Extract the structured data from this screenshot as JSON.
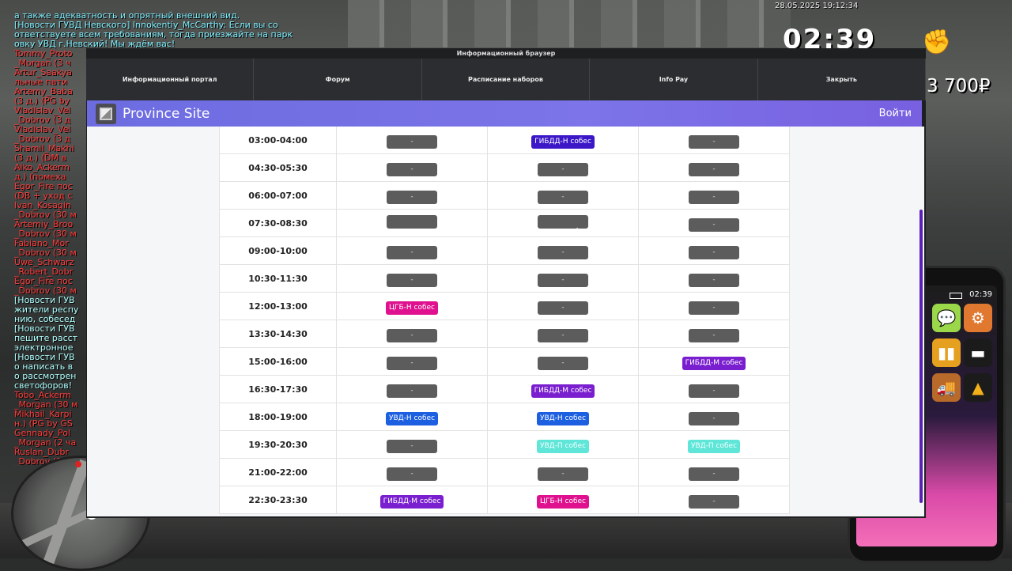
{
  "hud": {
    "datetime": "28.05.2025 19:12:34",
    "time": "02:39",
    "money": "3 700₽",
    "phone_time": "02:39"
  },
  "chat": [
    {
      "text": "а также адекватность и опрятный внешний вид.",
      "type": "info"
    },
    {
      "text": "[Новости ГУВД Невского] Innokentiy_McCarthy: Если вы со",
      "type": "info"
    },
    {
      "text": "ответствуете всем требованиям, тогда приезжайте на парк",
      "type": "info"
    },
    {
      "text": "овку УВД г.Невский! Мы ждём вас!",
      "type": "info"
    },
    {
      "text": "Tommy_Proto",
      "type": "nick"
    },
    {
      "text": "_Morgan (3 ч",
      "type": "nick"
    },
    {
      "text": "Artur_Saakya",
      "type": "nick"
    },
    {
      "text": "льные пати",
      "type": "nick"
    },
    {
      "text": "Artemy_Baba",
      "type": "nick"
    },
    {
      "text": "(3 д.) (PG by",
      "type": "nick"
    },
    {
      "text": "Vladislav_Vel",
      "type": "nick"
    },
    {
      "text": "_Dobrov (3 д",
      "type": "nick"
    },
    {
      "text": "Vladislav_Vel",
      "type": "nick"
    },
    {
      "text": "_Dobrov (3 д",
      "type": "nick"
    },
    {
      "text": "Shamil_Makhi",
      "type": "nick"
    },
    {
      "text": "(3 д.) (DM в",
      "type": "nick"
    },
    {
      "text": "Aiko_Ackerm",
      "type": "nick"
    },
    {
      "text": "д.) (помеха",
      "type": "nick"
    },
    {
      "text": "Egor_Fire пос",
      "type": "nick"
    },
    {
      "text": "(DB + уход с",
      "type": "nick"
    },
    {
      "text": "Ivan_Kosagin",
      "type": "nick"
    },
    {
      "text": "_Dobrov (30 м",
      "type": "nick"
    },
    {
      "text": "Artemiy_Broo",
      "type": "nick"
    },
    {
      "text": "_Dobrov (30 м",
      "type": "nick"
    },
    {
      "text": "Fabiano_Mor",
      "type": "nick"
    },
    {
      "text": "_Dobrov (30 м",
      "type": "nick"
    },
    {
      "text": "Uwe_Schwarz",
      "type": "nick"
    },
    {
      "text": "_Robert_Dobr",
      "type": "nick"
    },
    {
      "text": "Egor_Fire пос",
      "type": "nick"
    },
    {
      "text": "_Dobrov (30 м",
      "type": "nick"
    },
    {
      "text": "[Новости ГУВ",
      "type": "news"
    },
    {
      "text": "жители респу",
      "type": "news"
    },
    {
      "text": "нию, собесед",
      "type": "news"
    },
    {
      "text": "[Новости ГУВ",
      "type": "news"
    },
    {
      "text": "пешите расст",
      "type": "news"
    },
    {
      "text": "электронное",
      "type": "news"
    },
    {
      "text": "[Новости ГУВ",
      "type": "news"
    },
    {
      "text": "о написать в",
      "type": "news"
    },
    {
      "text": "о рассмотрен",
      "type": "news"
    },
    {
      "text": "светофоров!",
      "type": "news"
    },
    {
      "text": "Tobo_Ackerm",
      "type": "nick"
    },
    {
      "text": "_Morgan (30 м",
      "type": "nick"
    },
    {
      "text": "Mikhail_Karpi",
      "type": "nick"
    },
    {
      "text": "н.) (PG by GS",
      "type": "nick"
    },
    {
      "text": "Gennady_Pol",
      "type": "nick"
    },
    {
      "text": "_Morgan (2 ча",
      "type": "nick"
    },
    {
      "text": "Ruslan_Dubr",
      "type": "nick"
    },
    {
      "text": "_Dobrov (30 м",
      "type": "nick"
    }
  ],
  "browser": {
    "title": "Информационный браузер",
    "tabs": [
      {
        "label": "Информационный портал"
      },
      {
        "label": "Форум"
      },
      {
        "label": "Расписание наборов"
      },
      {
        "label": "Info Pay"
      },
      {
        "label": "Закрыть"
      }
    ]
  },
  "site": {
    "name": "Province Site",
    "login": "Войти"
  },
  "schedule": [
    {
      "time": "03:00-04:00",
      "slots": [
        {
          "label": "-",
          "kind": "empty"
        },
        {
          "label": "ГИБДД-Н собес",
          "kind": "gibdd-n"
        },
        {
          "label": "-",
          "kind": "empty"
        }
      ]
    },
    {
      "time": "04:30-05:30",
      "slots": [
        {
          "label": "-",
          "kind": "empty"
        },
        {
          "label": "-",
          "kind": "empty"
        },
        {
          "label": "-",
          "kind": "empty"
        }
      ]
    },
    {
      "time": "06:00-07:00",
      "slots": [
        {
          "label": "-",
          "kind": "empty"
        },
        {
          "label": "-",
          "kind": "empty"
        },
        {
          "label": "-",
          "kind": "empty"
        }
      ]
    },
    {
      "time": "07:30-08:30",
      "slots": [
        {
          "label": "",
          "kind": "empty"
        },
        {
          "label": "",
          "kind": "empty"
        },
        {
          "label": "-",
          "kind": "empty"
        }
      ]
    },
    {
      "time": "09:00-10:00",
      "slots": [
        {
          "label": "-",
          "kind": "empty"
        },
        {
          "label": "-",
          "kind": "empty"
        },
        {
          "label": "-",
          "kind": "empty"
        }
      ]
    },
    {
      "time": "10:30-11:30",
      "slots": [
        {
          "label": "-",
          "kind": "empty"
        },
        {
          "label": "-",
          "kind": "empty"
        },
        {
          "label": "-",
          "kind": "empty"
        }
      ]
    },
    {
      "time": "12:00-13:00",
      "slots": [
        {
          "label": "ЦГБ-Н собес",
          "kind": "cgb-n"
        },
        {
          "label": "-",
          "kind": "empty"
        },
        {
          "label": "-",
          "kind": "empty"
        }
      ]
    },
    {
      "time": "13:30-14:30",
      "slots": [
        {
          "label": "-",
          "kind": "empty"
        },
        {
          "label": "-",
          "kind": "empty"
        },
        {
          "label": "-",
          "kind": "empty"
        }
      ]
    },
    {
      "time": "15:00-16:00",
      "slots": [
        {
          "label": "-",
          "kind": "empty"
        },
        {
          "label": "-",
          "kind": "empty"
        },
        {
          "label": "ГИБДД-М собес",
          "kind": "gibdd-m"
        }
      ]
    },
    {
      "time": "16:30-17:30",
      "slots": [
        {
          "label": "-",
          "kind": "empty"
        },
        {
          "label": "ГИБДД-М собес",
          "kind": "gibdd-m"
        },
        {
          "label": "-",
          "kind": "empty"
        }
      ]
    },
    {
      "time": "18:00-19:00",
      "slots": [
        {
          "label": "УВД-Н собес",
          "kind": "uvd-n"
        },
        {
          "label": "УВД-Н собес",
          "kind": "uvd-n"
        },
        {
          "label": "-",
          "kind": "empty"
        }
      ]
    },
    {
      "time": "19:30-20:30",
      "slots": [
        {
          "label": "-",
          "kind": "empty"
        },
        {
          "label": "УВД-П собес",
          "kind": "uvd-p"
        },
        {
          "label": "УВД-П собес",
          "kind": "uvd-p"
        }
      ]
    },
    {
      "time": "21:00-22:00",
      "slots": [
        {
          "label": "-",
          "kind": "empty"
        },
        {
          "label": "-",
          "kind": "empty"
        },
        {
          "label": "-",
          "kind": "empty"
        }
      ]
    },
    {
      "time": "22:30-23:30",
      "slots": [
        {
          "label": "ГИБДД-М собес",
          "kind": "gibdd-m"
        },
        {
          "label": "ЦГБ-Н собес",
          "kind": "cgb-n"
        },
        {
          "label": "-",
          "kind": "empty"
        }
      ]
    }
  ],
  "icons": {
    "fist": "fist-icon",
    "logo": "site-logo-icon",
    "cursor": "mouse-cursor-icon"
  },
  "colors": {
    "header": "#6c6ce0",
    "gibdd_n": "#3b17c7",
    "gibdd_m": "#7a1fcf",
    "cgb_n": "#e0118e",
    "uvd_n": "#1c5fe0",
    "uvd_p": "#5fe6d8",
    "empty": "#5c5c5c"
  }
}
